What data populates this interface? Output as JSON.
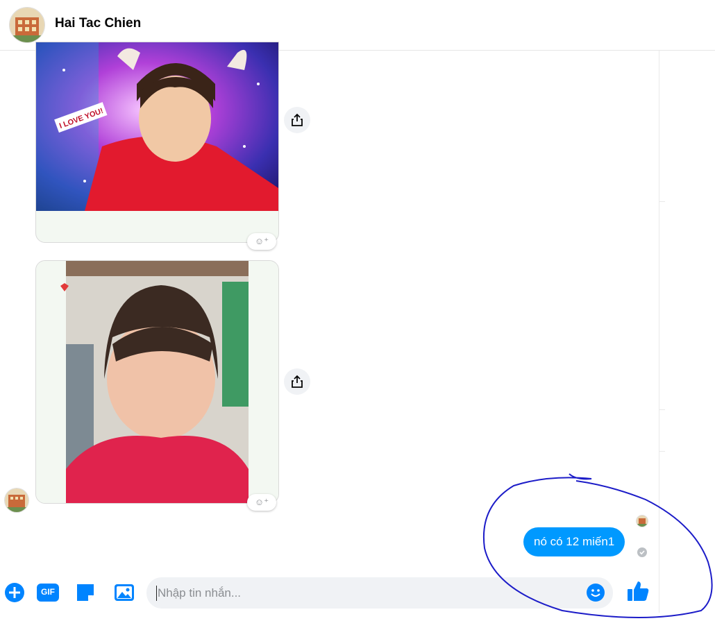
{
  "header": {
    "title": "Hai Tac Chien"
  },
  "messages": {
    "photo_1_sticker_text": "I LOVE YOU!",
    "outgoing_text": "nó có 12 miến1"
  },
  "composer": {
    "placeholder": "Nhập tin nhắn...",
    "gif_label": "GIF"
  },
  "colors": {
    "accent": "#0099ff",
    "annotation": "#1c1cc8"
  },
  "icons": [
    "plus-circle-icon",
    "gif-icon",
    "sticker-icon",
    "photo-icon",
    "emoji-icon",
    "thumbs-up-icon",
    "share-icon",
    "add-reaction-icon",
    "sent-check-icon"
  ]
}
